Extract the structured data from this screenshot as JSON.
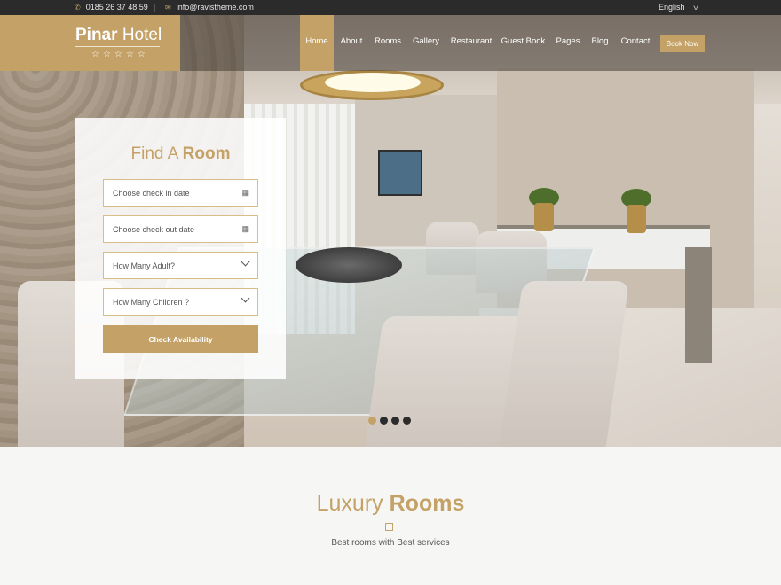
{
  "topbar": {
    "phone": "0185 26 37 48 59",
    "phone_icon": "phone-icon",
    "separator": "|",
    "email": "info@ravistheme.com",
    "email_icon": "mail-icon",
    "language": "English"
  },
  "brand": {
    "name_bold": "Pinar",
    "name_light": "Hotel",
    "stars": "☆☆☆☆☆"
  },
  "nav": {
    "items": [
      "Home",
      "About",
      "Rooms",
      "Gallery",
      "Restaurant",
      "Guest Book",
      "Pages",
      "Blog",
      "Contact"
    ],
    "active": "Home",
    "book_label": "Book Now"
  },
  "find_room": {
    "title_light": "Find A",
    "title_bold": "Room",
    "checkin_placeholder": "Choose check in date",
    "checkout_placeholder": "Choose check out date",
    "adults_label": "How Many Adult?",
    "children_label": "How Many Children ?",
    "button_label": "Check Availability"
  },
  "slider": {
    "total": 4,
    "active": 1
  },
  "rooms_section": {
    "title_light": "Luxury",
    "title_bold": "Rooms",
    "subtitle": "Best rooms with Best services"
  },
  "colors": {
    "accent": "#c4a166",
    "topbar": "#2b2b2b"
  }
}
